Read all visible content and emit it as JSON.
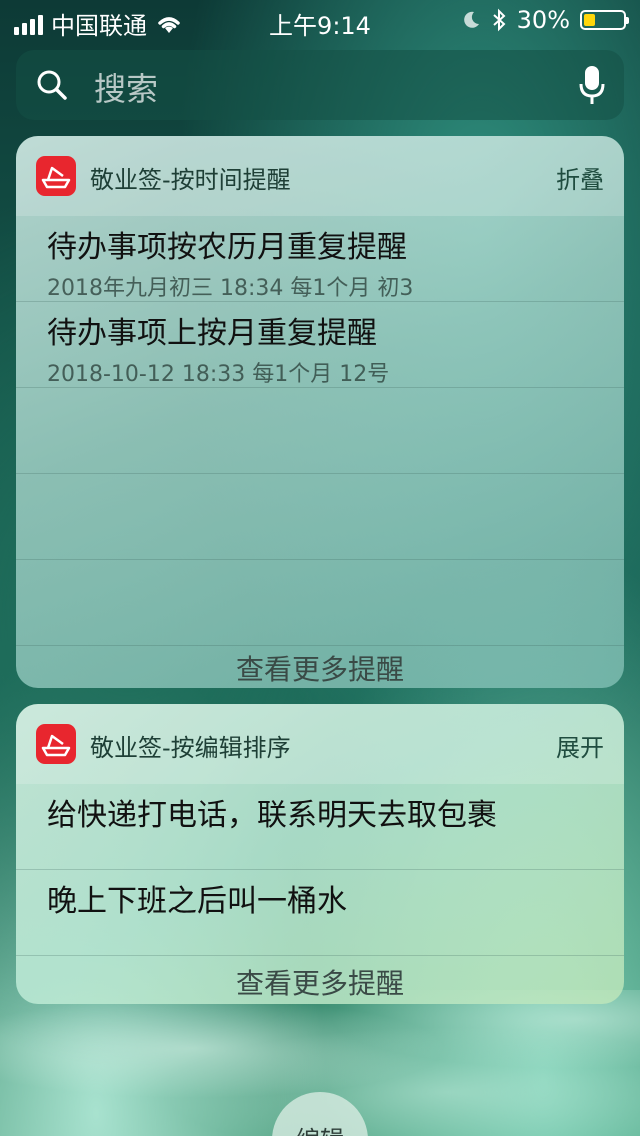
{
  "status_bar": {
    "carrier": "中国联通",
    "time": "上午9:14",
    "battery_percent": "30%",
    "battery_level": 0.3,
    "battery_color": "#ffd60a"
  },
  "search": {
    "placeholder": "搜索",
    "icons": [
      "magnifier-icon",
      "microphone-icon"
    ]
  },
  "widget_time": {
    "app_name": "敬业签-按时间提醒",
    "action": "折叠",
    "items": [
      {
        "title": "待办事项按农历月重复提醒",
        "detail": "2018年九月初三 18:34 每1个月 初3"
      },
      {
        "title": "待办事项上按月重复提醒",
        "detail": "2018-10-12 18:33 每1个月 12号"
      }
    ],
    "more": "查看更多提醒"
  },
  "widget_edit": {
    "app_name": "敬业签-按编辑排序",
    "action": "展开",
    "items": [
      {
        "title": "给快递打电话，联系明天去取包裹"
      },
      {
        "title": "晚上下班之后叫一桶水"
      }
    ],
    "more": "查看更多提醒"
  },
  "edit_button": {
    "label": "编辑"
  },
  "colors": {
    "app_icon": "#e8262e"
  }
}
